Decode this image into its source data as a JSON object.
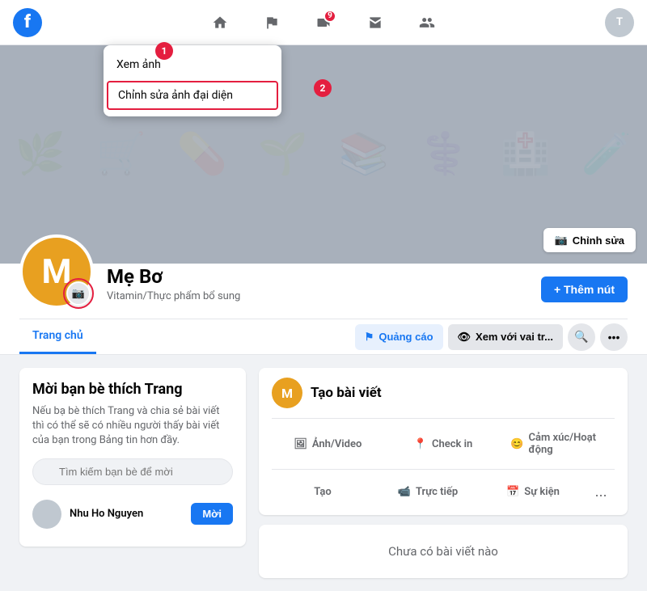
{
  "nav": {
    "home_icon": "🏠",
    "flag_icon": "⚑",
    "video_icon": "▶",
    "store_icon": "🏪",
    "people_icon": "👥",
    "badge_count": "9",
    "user_initials": "T"
  },
  "cover": {
    "edit_button_label": "Chỉnh sửa",
    "camera_icon": "📷"
  },
  "profile": {
    "name": "Mẹ Bơ",
    "category": "Vitamin/Thực phẩm bổ sung",
    "add_button_label": "+ Thêm nút",
    "avatar_letter": "M"
  },
  "context_menu": {
    "view_photo_label": "Xem ảnh",
    "edit_avatar_label": "Chỉnh sửa ảnh đại diện"
  },
  "steps": {
    "step1": "1",
    "step2": "2"
  },
  "tabs": {
    "trang_chu": "Trang chủ",
    "quang_cao": "Quảng cáo",
    "xem_vai_tro": "Xem với vai tr...",
    "search_icon": "🔍",
    "more_icon": "..."
  },
  "invite_card": {
    "title": "Mời bạn bè thích Trang",
    "description": "Nếu bạ bè thích Trang và chia sẻ bài viết thì có thể sẽ có nhiều người thấy bài viết của bạn trong Bảng tin hơn đầy.",
    "search_placeholder": "Tìm kiếm bạn bè để mời",
    "friend_name": "Nhu Ho Nguyen",
    "invite_btn_label": "Mời"
  },
  "create_post": {
    "title": "Tạo bài viết",
    "avatar_letter": "M",
    "photo_video_label": "Ảnh/Video",
    "checkin_label": "Check in",
    "feeling_label": "Cảm xúc/Hoạt động",
    "live_label": "Trực tiếp",
    "event_label": "Sự kiện",
    "more_label": "...",
    "create_label": "Tạo",
    "photo_icon": "🖼",
    "location_icon": "📍",
    "smile_icon": "😊",
    "video_icon": "📹",
    "calendar_icon": "📅"
  },
  "no_posts": {
    "label": "Chưa có bài viết nào"
  },
  "colors": {
    "primary": "#1877f2",
    "danger": "#e41e3f",
    "bg": "#f0f2f5",
    "avatar_yellow": "#e8a020"
  }
}
